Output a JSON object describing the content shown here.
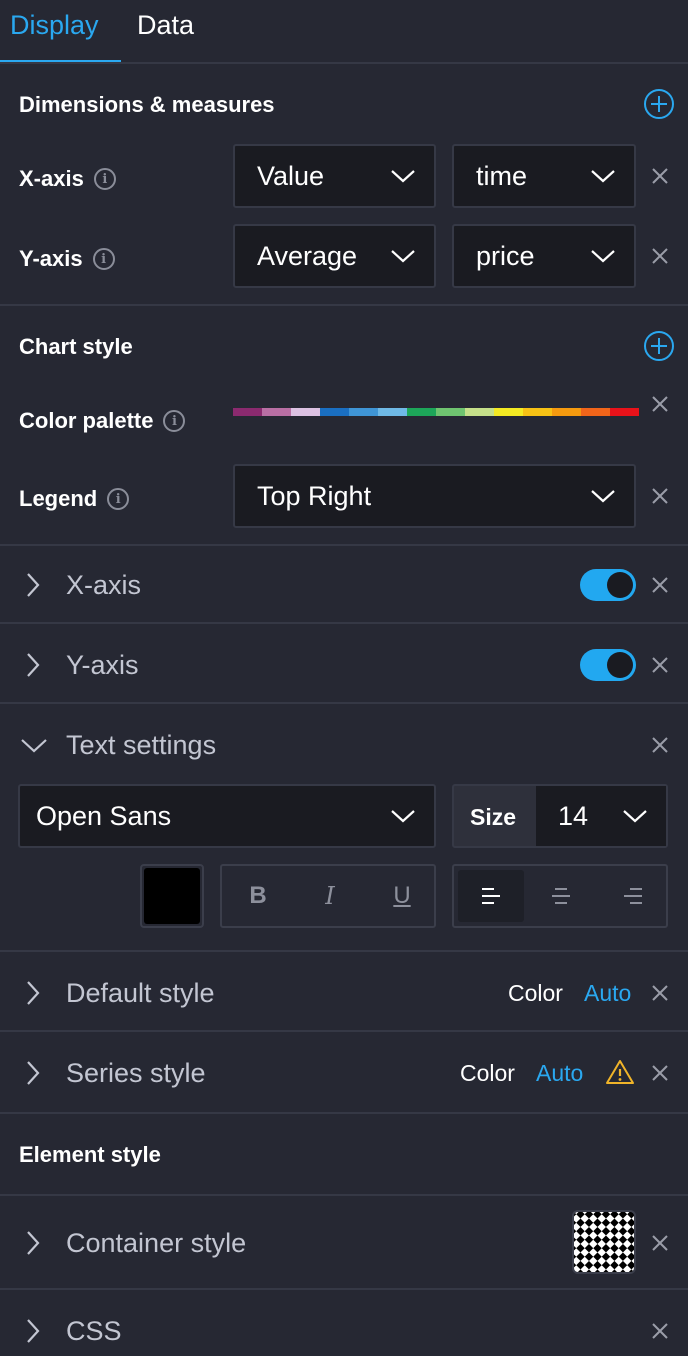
{
  "tabs": [
    {
      "label": "Display",
      "active": true
    },
    {
      "label": "Data",
      "active": false
    }
  ],
  "dimensions": {
    "title": "Dimensions & measures",
    "x_axis": {
      "label": "X-axis",
      "aggregation": "Value",
      "field": "time"
    },
    "y_axis": {
      "label": "Y-axis",
      "aggregation": "Average",
      "field": "price"
    }
  },
  "chart_style": {
    "title": "Chart style",
    "color_palette_label": "Color palette",
    "palette_colors": [
      "#8b2a6f",
      "#b96fa4",
      "#dcc1e2",
      "#1a6fc2",
      "#3f95d6",
      "#6fb9e6",
      "#1da659",
      "#6fc470",
      "#c5e08a",
      "#f4ea23",
      "#f7c215",
      "#f59a0f",
      "#f1651a",
      "#e8121a"
    ],
    "legend_label": "Legend",
    "legend_value": "Top Right"
  },
  "collapsibles": {
    "x_axis": {
      "label": "X-axis",
      "enabled": true
    },
    "y_axis": {
      "label": "Y-axis",
      "enabled": true
    },
    "text_settings": {
      "label": "Text settings",
      "font": "Open Sans",
      "size_label": "Size",
      "size_value": "14",
      "text_color": "#000000",
      "bold": "B",
      "italic": "I",
      "underline": "U"
    },
    "default_style": {
      "label": "Default style",
      "color_label": "Color",
      "color_value": "Auto"
    },
    "series_style": {
      "label": "Series style",
      "color_label": "Color",
      "color_value": "Auto"
    }
  },
  "element_style": {
    "title": "Element style",
    "container_style": "Container style",
    "css": "CSS"
  },
  "colors": {
    "accent": "#2aa8f0",
    "background": "#262833",
    "input_bg": "#1a1b21",
    "warning": "#f0b429"
  }
}
